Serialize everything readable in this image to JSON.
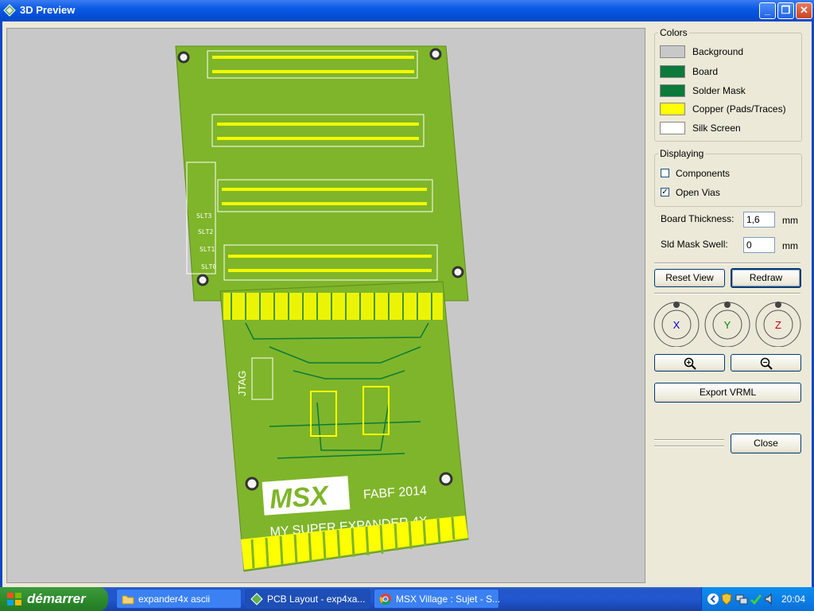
{
  "window": {
    "title": "3D Preview"
  },
  "colors": {
    "legend": "Colors",
    "items": [
      {
        "label": "Background",
        "color": "#c8c8c8"
      },
      {
        "label": "Board",
        "color": "#0b7a3a"
      },
      {
        "label": "Solder Mask",
        "color": "#0b7a3a"
      },
      {
        "label": "Copper (Pads/Traces)",
        "color": "#ffff00"
      },
      {
        "label": "Silk Screen",
        "color": "#ffffff"
      }
    ]
  },
  "displaying": {
    "legend": "Displaying",
    "components": {
      "label": "Components",
      "checked": false
    },
    "open_vias": {
      "label": "Open Vias",
      "checked": true
    }
  },
  "board_thickness": {
    "label": "Board Thickness:",
    "value": "1,6",
    "unit": "mm"
  },
  "mask_swell": {
    "label": "Sld Mask Swell:",
    "value": "0",
    "unit": "mm"
  },
  "buttons": {
    "reset_view": "Reset View",
    "redraw": "Redraw",
    "export_vrml": "Export VRML",
    "close": "Close"
  },
  "axes": {
    "x": "X",
    "y": "Y",
    "z": "Z"
  },
  "pcb": {
    "logo": "MSX",
    "text_fabf": "FABF 2014",
    "text_title": "MY SUPER EXPANDER 4X",
    "jtag": "JTAG",
    "slot_labels": [
      "SLT3",
      "SLT2",
      "SLT1",
      "SLT0"
    ]
  },
  "taskbar": {
    "start": "démarrer",
    "tasks": [
      "expander4x ascii",
      "PCB Layout - exp4xa...",
      "MSX Village : Sujet - S..."
    ],
    "clock": "20:04"
  }
}
